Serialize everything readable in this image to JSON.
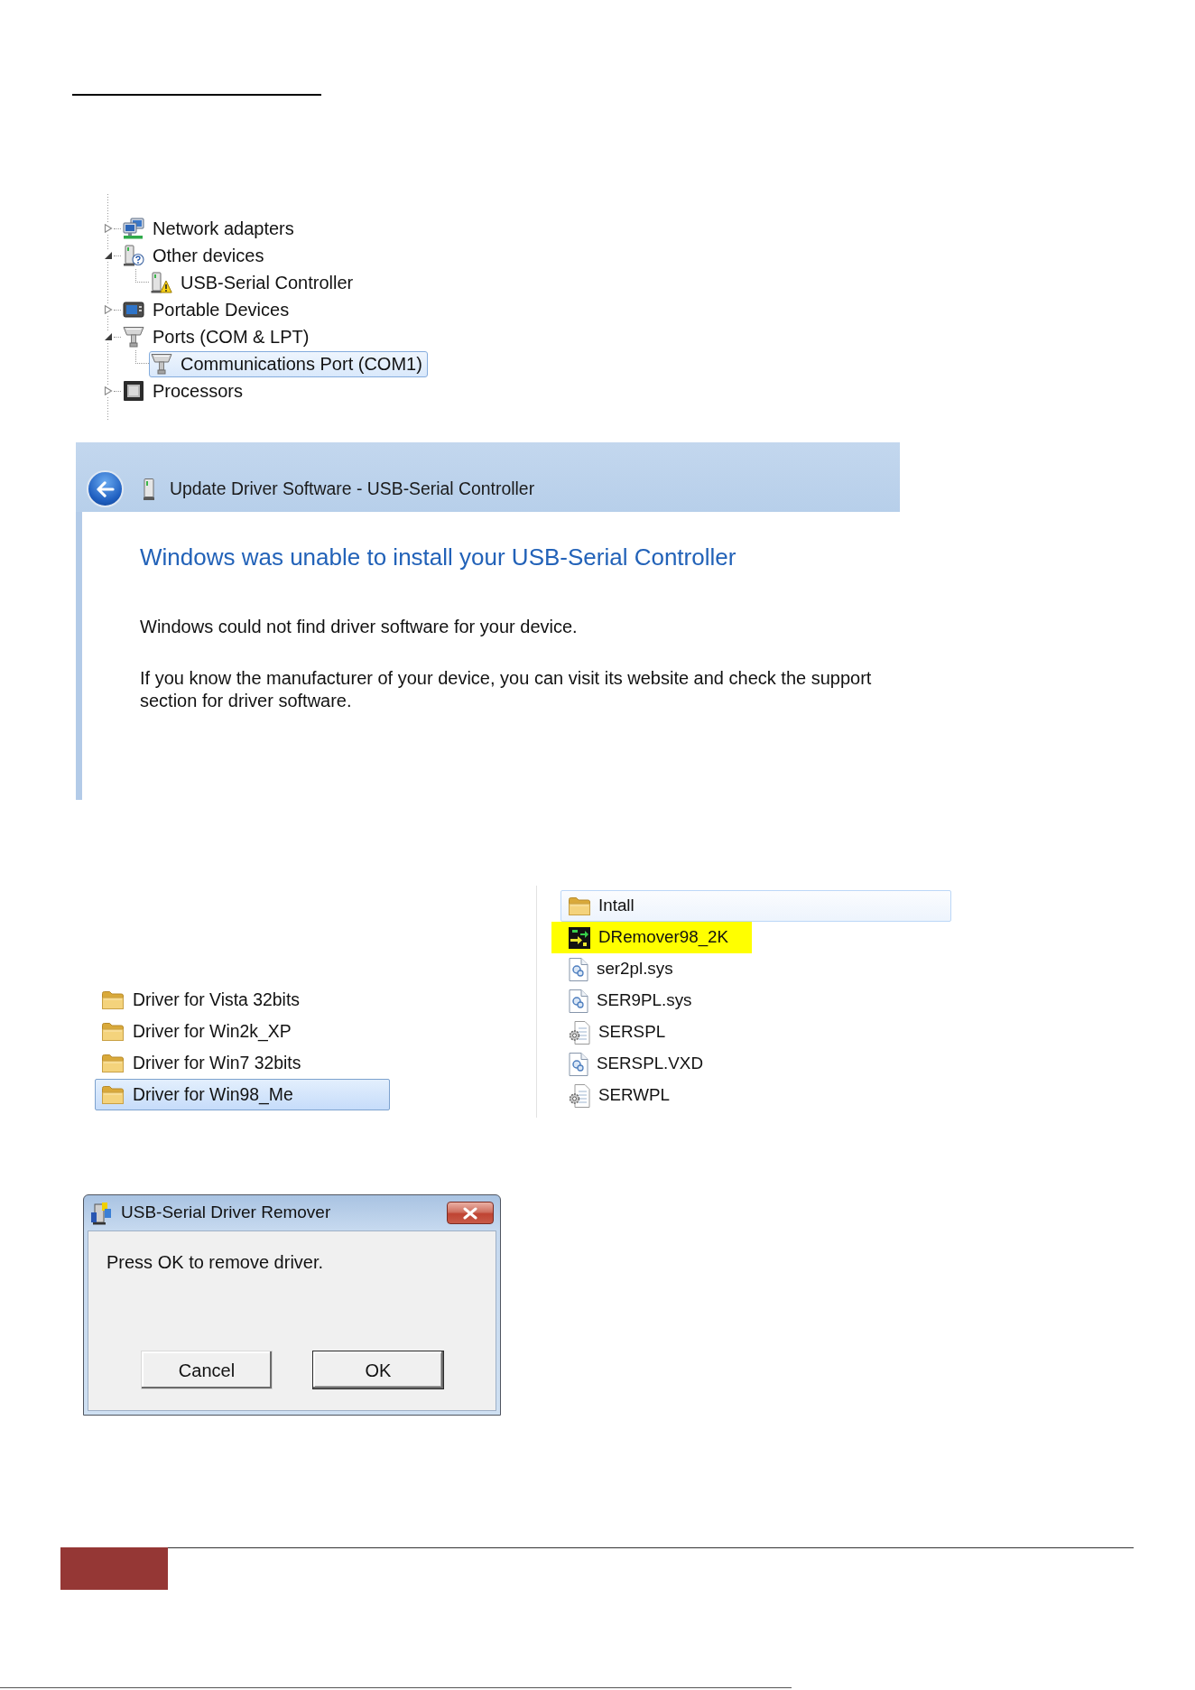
{
  "device_tree": {
    "items": [
      {
        "label": "Network adapters",
        "kind": "network",
        "expanded": false,
        "selected": false
      },
      {
        "label": "Other devices",
        "kind": "unknown",
        "expanded": true,
        "selected": false,
        "children": [
          {
            "label": "USB-Serial Controller",
            "kind": "problem",
            "selected": false
          }
        ]
      },
      {
        "label": "Portable Devices",
        "kind": "portable",
        "expanded": false,
        "selected": false
      },
      {
        "label": "Ports (COM & LPT)",
        "kind": "port",
        "expanded": true,
        "selected": false,
        "children": [
          {
            "label": "Communications Port (COM1)",
            "kind": "port",
            "selected": true
          }
        ]
      },
      {
        "label": "Processors",
        "kind": "processor",
        "expanded": false,
        "selected": false
      }
    ]
  },
  "update_driver_window": {
    "title": "Update Driver Software - USB-Serial Controller",
    "heading": "Windows was unable to install your USB-Serial Controller",
    "paragraphs": [
      "Windows could not find driver software for your device.",
      "If you know the manufacturer of your device, you can visit its website and check the support section for driver software."
    ]
  },
  "folder_list": {
    "items": [
      {
        "name": "Driver for Vista 32bits",
        "selected": false
      },
      {
        "name": "Driver for Win2k_XP",
        "selected": false
      },
      {
        "name": "Driver for Win7 32bits",
        "selected": false
      },
      {
        "name": "Driver for Win98_Me",
        "selected": true
      }
    ]
  },
  "file_list": {
    "items": [
      {
        "name": "Intall",
        "kind": "folder",
        "selected": false,
        "hovered": true,
        "highlighted": false
      },
      {
        "name": "DRemover98_2K",
        "kind": "program",
        "selected": false,
        "hovered": false,
        "highlighted": true
      },
      {
        "name": "ser2pl.sys",
        "kind": "driver",
        "selected": false,
        "hovered": false,
        "highlighted": false
      },
      {
        "name": "SER9PL.sys",
        "kind": "driver",
        "selected": false,
        "hovered": false,
        "highlighted": false
      },
      {
        "name": "SERSPL",
        "kind": "settings",
        "selected": false,
        "hovered": false,
        "highlighted": false
      },
      {
        "name": "SERSPL.VXD",
        "kind": "driver",
        "selected": false,
        "hovered": false,
        "highlighted": false
      },
      {
        "name": "SERWPL",
        "kind": "settings",
        "selected": false,
        "hovered": false,
        "highlighted": false
      }
    ]
  },
  "remover_dialog": {
    "title": "USB-Serial Driver Remover",
    "message": "Press OK to remove driver.",
    "buttons": [
      {
        "label": "Cancel",
        "default": false
      },
      {
        "label": "OK",
        "default": true
      }
    ]
  }
}
